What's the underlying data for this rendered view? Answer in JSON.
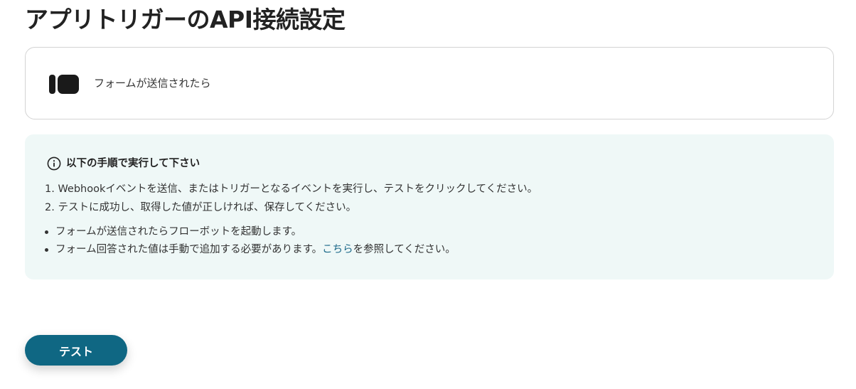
{
  "page": {
    "title": "アプリトリガーのAPI接続設定"
  },
  "trigger": {
    "icon": "form-app-icon",
    "label": "フォームが送信されたら"
  },
  "info": {
    "icon": "info-circle-icon",
    "title": "以下の手順で実行して下さい",
    "steps": [
      "1. Webhookイベントを送信、またはトリガーとなるイベントを実行し、テストをクリックしてください。",
      "2. テストに成功し、取得した値が正しければ、保存してください。"
    ],
    "notes": [
      {
        "text": "フォームが送信されたらフローボットを起動します。"
      },
      {
        "text_before": "フォーム回答された値は手動で追加する必要があります。",
        "link_text": "こちら",
        "text_after": "を参照してください。"
      }
    ]
  },
  "actions": {
    "test_label": "テスト"
  },
  "colors": {
    "accent": "#0f6783",
    "link": "#1d6a8a",
    "info_background": "#eff8f7",
    "card_border": "#d3d3d3"
  }
}
